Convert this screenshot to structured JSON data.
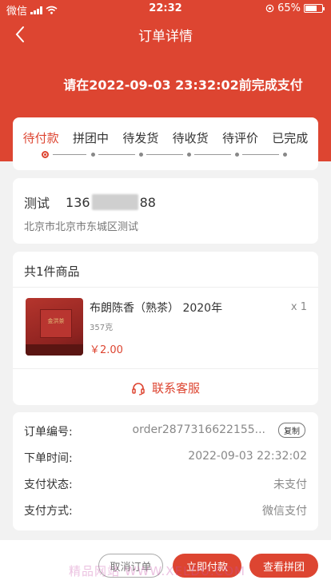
{
  "status_bar": {
    "carrier": "微信",
    "time": "22:32",
    "battery": "65%"
  },
  "nav": {
    "title": "订单详情"
  },
  "deadline_text": "请在2022-09-03 23:32:02前完成支付",
  "tabs": [
    {
      "label": "待付款",
      "active": true
    },
    {
      "label": "拼团中",
      "active": false
    },
    {
      "label": "待发货",
      "active": false
    },
    {
      "label": "待收货",
      "active": false
    },
    {
      "label": "待评价",
      "active": false
    },
    {
      "label": "已完成",
      "active": false
    }
  ],
  "address": {
    "name": "测试",
    "phone_prefix": "136",
    "phone_suffix": "88",
    "detail": "北京市北京市东城区测试"
  },
  "goods": {
    "header": "共1件商品",
    "image_caption": "金洪茶",
    "name": "布朗陈香（熟茶） 2020年",
    "spec": "357克",
    "price": "￥2.00",
    "qty": "x 1"
  },
  "service": {
    "label": "联系客服"
  },
  "order_info": {
    "order_no_label": "订单编号:",
    "order_no": "order2877316622155...",
    "copy_label": "复制",
    "time_label": "下单时间:",
    "time": "2022-09-03 22:32:02",
    "pay_status_label": "支付状态:",
    "pay_status": "未支付",
    "pay_method_label": "支付方式:",
    "pay_method": "微信支付"
  },
  "footer": {
    "cancel_label": "取消订单",
    "pay_label": "立即付款",
    "group_label": "查看拼团",
    "watermark": "精品网站 WWW.XELDU.COM"
  },
  "colors": {
    "accent": "#dd4531",
    "background": "#f2f2f2"
  }
}
